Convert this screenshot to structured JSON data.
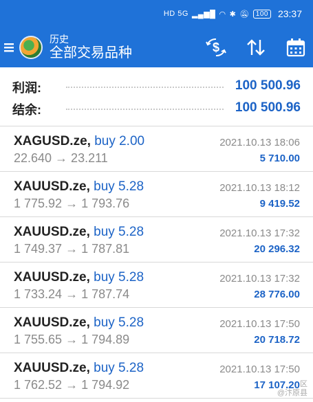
{
  "status_bar": {
    "network": "HD 5G",
    "battery": "100",
    "time": "23:37"
  },
  "app_bar": {
    "subtitle": "历史",
    "title": "全部交易品种",
    "icons": [
      "menu-icon",
      "app-logo",
      "currency-exchange-icon",
      "sort-icon",
      "calendar-icon"
    ]
  },
  "summary": {
    "profit_label": "利润:",
    "profit_value": "100 500.96",
    "balance_label": "结余:",
    "balance_value": "100 500.96"
  },
  "trades": [
    {
      "symbol": "XAGUSD.ze,",
      "direction": "buy 2.00",
      "prices": "22.640 → 23.211",
      "datetime": "2021.10.13 18:06",
      "profit": "5 710.00"
    },
    {
      "symbol": "XAUUSD.ze,",
      "direction": "buy 5.28",
      "prices": "1 775.92 → 1 793.76",
      "datetime": "2021.10.13 18:12",
      "profit": "9 419.52"
    },
    {
      "symbol": "XAUUSD.ze,",
      "direction": "buy 5.28",
      "prices": "1 749.37 → 1 787.81",
      "datetime": "2021.10.13 17:32",
      "profit": "20 296.32"
    },
    {
      "symbol": "XAUUSD.ze,",
      "direction": "buy 5.28",
      "prices": "1 733.24 → 1 787.74",
      "datetime": "2021.10.13 17:32",
      "profit": "28 776.00"
    },
    {
      "symbol": "XAUUSD.ze,",
      "direction": "buy 5.28",
      "prices": "1 755.65 → 1 794.89",
      "datetime": "2021.10.13 17:50",
      "profit": "20 718.72"
    },
    {
      "symbol": "XAUUSD.ze,",
      "direction": "buy 5.28",
      "prices": "1 762.52 → 1 794.92",
      "datetime": "2021.10.13 17:50",
      "profit": "17 107.20"
    }
  ],
  "watermark": {
    "line1": "区",
    "line2": "@汴原县"
  },
  "colors": {
    "app_bar": "#1f72d8",
    "accent_value": "#1c63c6",
    "muted_text": "#8a8a8a"
  }
}
